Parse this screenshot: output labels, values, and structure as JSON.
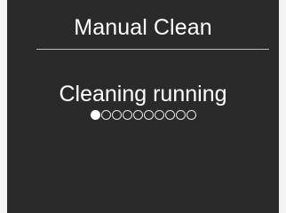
{
  "screen": {
    "title": "Manual Clean",
    "status": "Cleaning running",
    "progress": {
      "total_steps": 10,
      "current_step": 1
    }
  }
}
